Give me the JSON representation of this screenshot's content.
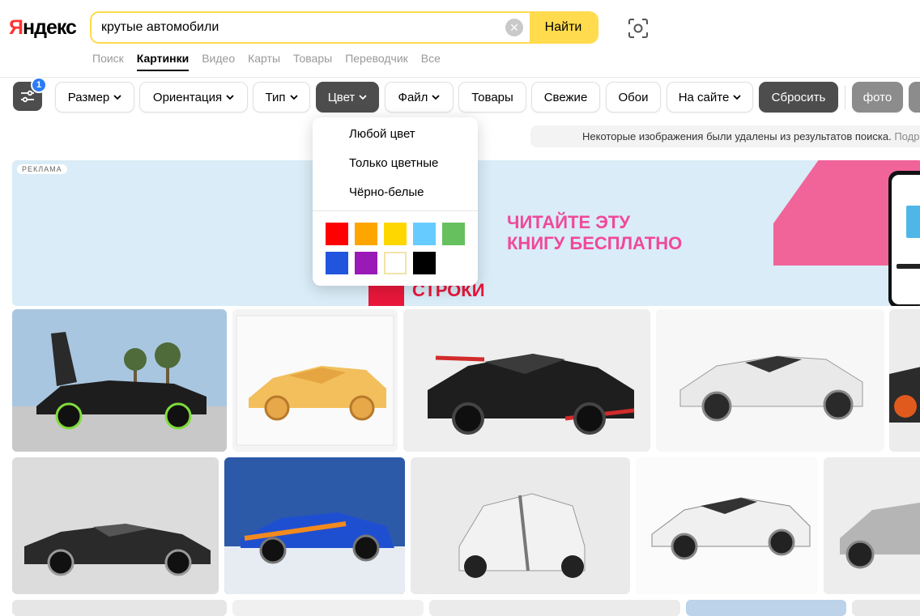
{
  "header": {
    "logo_first": "Я",
    "logo_rest": "ндекс",
    "search_value": "крутые автомобили",
    "find_label": "Найти"
  },
  "nav": {
    "tabs": [
      "Поиск",
      "Картинки",
      "Видео",
      "Карты",
      "Товары",
      "Переводчик",
      "Все"
    ],
    "active": "Картинки"
  },
  "filters": {
    "badge_count": "1",
    "size": "Размер",
    "orientation": "Ориентация",
    "type": "Тип",
    "color": "Цвет",
    "file": "Файл",
    "goods": "Товары",
    "fresh": "Свежие",
    "wallpapers": "Обои",
    "on_site": "На сайте",
    "reset": "Сбросить",
    "photo": "фото"
  },
  "notice": {
    "text": "Некоторые изображения были удалены из результатов поиска.",
    "link": "Подр"
  },
  "ad": {
    "label": "РЕКЛАМА",
    "line1": "ЧИТАЙТЕ ЭТУ",
    "line2": "КНИГУ БЕСПЛАТНО",
    "brand": "СТРОКИ"
  },
  "color_menu": {
    "any": "Любой цвет",
    "colored": "Только цветные",
    "bw": "Чёрно-белые",
    "swatches": [
      "#ff0000",
      "#ffa500",
      "#ffd700",
      "#66ccff",
      "#66c05e",
      "#2255dd",
      "#9a1ab7",
      "#ffffff",
      "#000000"
    ]
  },
  "colors": {
    "accent_yellow": "#ffdb4d",
    "dark_button": "#4d4d4d",
    "badge_blue": "#2b7cf6"
  }
}
